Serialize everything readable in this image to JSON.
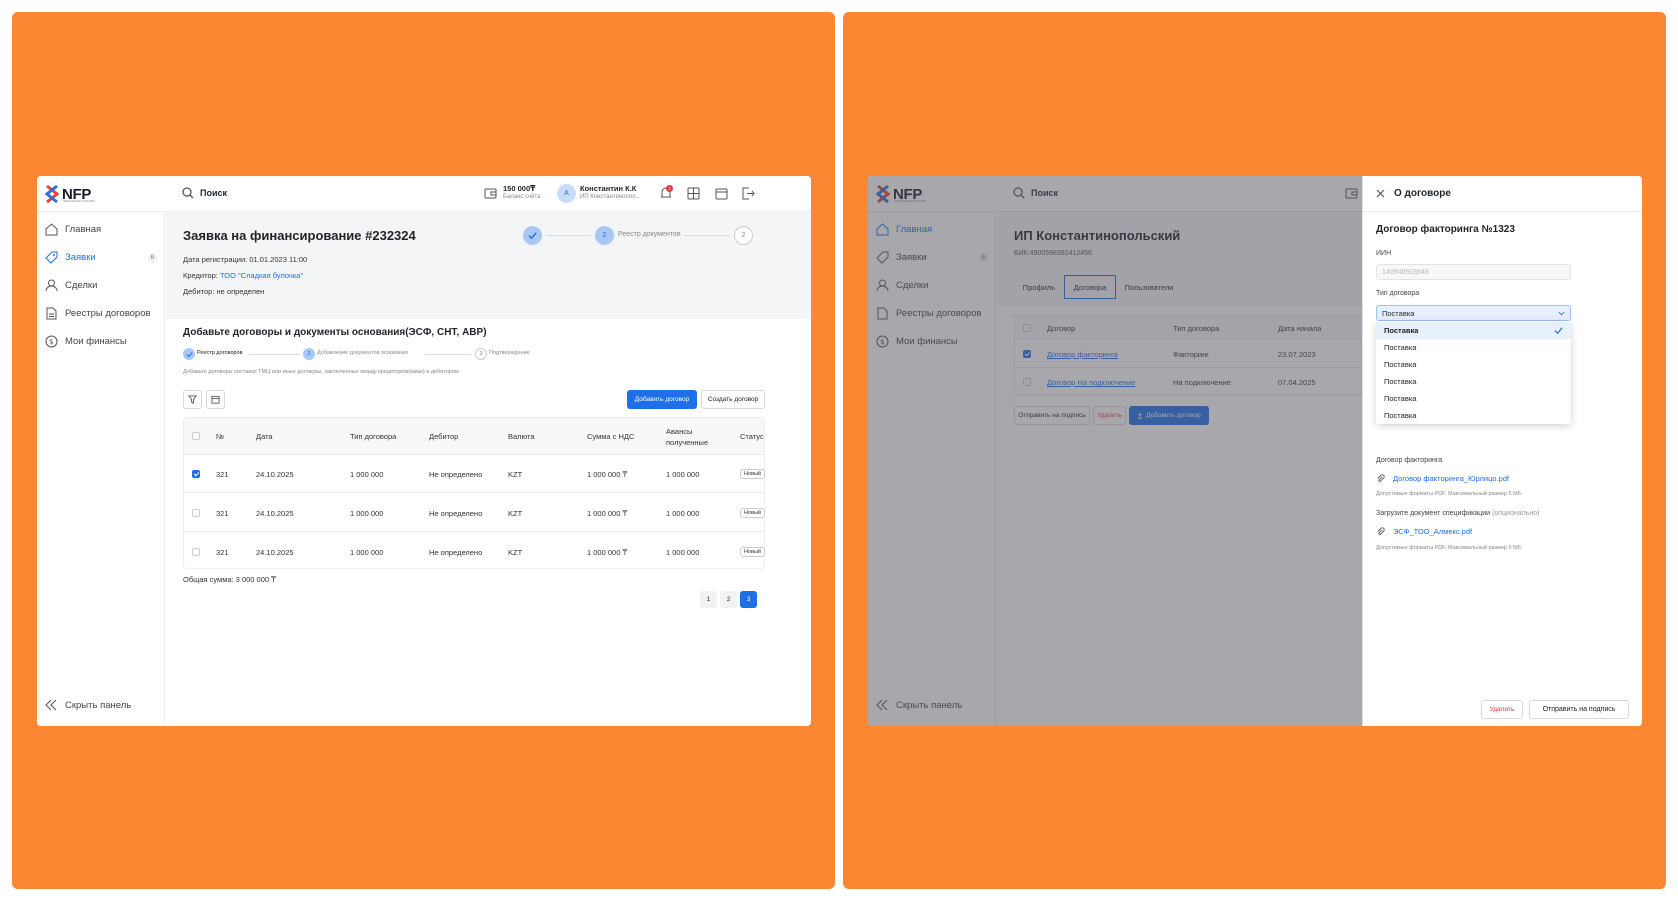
{
  "app": {
    "logo": "NFP",
    "logo_sub": "NEW FINANCE PLATFORM",
    "search": "Поиск",
    "balance": "150 000₸",
    "balance_caption": "Баланс счёта",
    "user": "Константин К.К",
    "user_org": "ИП Константинопол...",
    "avatar": "А",
    "notif_count": "1"
  },
  "nav": [
    {
      "label": "Главная"
    },
    {
      "label": "Заявки",
      "count": "6"
    },
    {
      "label": "Сделки"
    },
    {
      "label": "Реестры договоров"
    },
    {
      "label": "Мои финансы"
    }
  ],
  "hide_panel": "Скрыть панель",
  "left": {
    "title": "Заявка на финансирование #232324",
    "reg_date": "Дата регистрации: 01.01.2023 11:00",
    "creditor_label": "Кредитор: ",
    "creditor": "ТОО \"Сладкая булочка\"",
    "debtor": "Дебитор: не определен",
    "top_steps": [
      {
        "num": "",
        "label": ""
      },
      {
        "num": "2",
        "label": "Реестр документов"
      },
      {
        "num": "2",
        "label": ""
      }
    ],
    "section_title": "Добавьте договоры и документы основания(ЭСФ, СНТ, АВР)",
    "sub_steps": [
      {
        "num": "",
        "label": "Реестр договоров"
      },
      {
        "num": "2",
        "label": "Добавление документов основания"
      },
      {
        "num": "3",
        "label": "Подтверждение"
      }
    ],
    "description": "Добавьте договоры поставок ТМЦ или иные договоры, заключенные между кредитором(вами) и дебитором",
    "add_button": "Добавить договор",
    "create_button": "Создать договор",
    "columns": [
      "№",
      "Дата",
      "Тип договора",
      "Дебитор",
      "Валюта",
      "Сумма с НДС",
      "Авансы полученные",
      "Статус"
    ],
    "rows": [
      {
        "checked": true,
        "cells": [
          "321",
          "24.10.2025",
          "1 000 000",
          "Не определено",
          "KZT",
          "1 000 000 ₸",
          "1 000 000"
        ],
        "status": "Новый"
      },
      {
        "checked": false,
        "cells": [
          "321",
          "24.10.2025",
          "1 000 000",
          "Не определено",
          "KZT",
          "1 000 000 ₸",
          "1 000 000"
        ],
        "status": "Новый"
      },
      {
        "checked": false,
        "cells": [
          "321",
          "24.10.2025",
          "1 000 000",
          "Не определено",
          "KZT",
          "1 000 000 ₸",
          "1 000 000"
        ],
        "status": "Новый"
      }
    ],
    "total": "Общая сумма: 3 000 000 ₸",
    "pages": [
      "1",
      "2",
      "3"
    ],
    "active_page": "3"
  },
  "right": {
    "company": "ИП Константинопольский",
    "bin": "БИК:4900598392412456",
    "tabs": [
      "Профиль",
      "Договора",
      "Пользователи"
    ],
    "columns": [
      "Договор",
      "Тип договора",
      "Дата начала"
    ],
    "rows": [
      {
        "checked": true,
        "cells": [
          "Договор факторинга",
          "Факторинг",
          "23.07.2023"
        ]
      },
      {
        "checked": false,
        "cells": [
          "Договор На подключение",
          "На подключение",
          "07.04.2025"
        ]
      }
    ],
    "btn_sign": "Отправить на подпись",
    "btn_delete": "Удалить",
    "btn_add": "Добавить договор",
    "drawer": {
      "title": "О договоре",
      "contract_title": "Договор факторинга №1323",
      "iin_label": "ИИН",
      "iin_value": "140948503948",
      "type_label": "Тип договора",
      "type_value": "Поставка",
      "options": [
        "Поставка",
        "Поставка",
        "Поставка",
        "Поставка",
        "Поставка",
        "Поставка"
      ],
      "factoring_label": "Договор факторинга",
      "factoring_file": "Договор факторинга_Юрлицо.pdf",
      "formats1": "Допустимые форматы PDF. Максимальный размер 5 Мб.",
      "spec_label": "Загрузите документ спецификации",
      "spec_optional": "(опционально)",
      "spec_file": "ЭСФ_ТОО_Алмекс.pdf",
      "formats2": "Допустимые форматы PDF. Максимальный размер 5 Мб.",
      "delete": "Удалить",
      "send": "Отправить на подпись"
    }
  },
  "colors": {
    "accent": "#1e6fe8",
    "background": "#fb8733",
    "danger": "#e03a3a"
  }
}
